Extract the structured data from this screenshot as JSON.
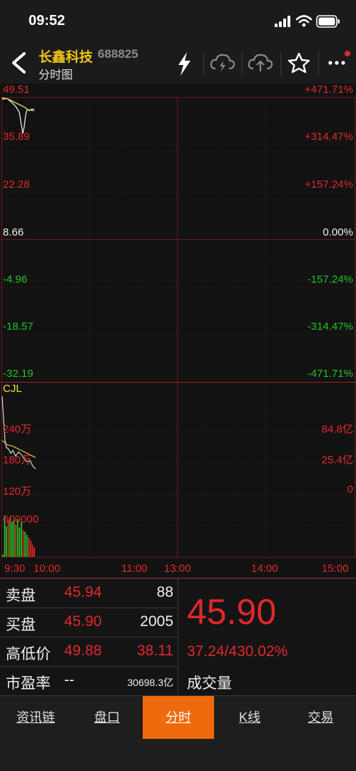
{
  "status_bar": {
    "time": "09:52"
  },
  "header": {
    "stock_name": "长鑫科技",
    "stock_code": "688825",
    "view_title": "分时图",
    "icons": [
      "back-chevron-icon",
      "lightning-icon",
      "cloud-lightning-icon",
      "cloud-upload-icon",
      "star-icon",
      "more-dots-icon"
    ]
  },
  "chart": {
    "price_labels": [
      "49.51",
      "35.89",
      "22.28",
      "8.66",
      "-4.96",
      "-18.57",
      "-32.19"
    ],
    "pct_labels": [
      "+471.71%",
      "+314.47%",
      "+157.24%",
      "0.00%",
      "-157.24%",
      "-314.47%",
      "-471.71%"
    ],
    "volume_title": "CJL",
    "volume_left_labels": [
      "240万",
      "180万",
      "120万",
      "600000"
    ],
    "volume_right_labels": [
      "84.8亿",
      "25.4亿",
      "0"
    ],
    "time_labels": [
      "9:30",
      "10:00",
      "11:00",
      "13:00",
      "14:00",
      "15:00"
    ],
    "colors": {
      "up": "#e0282d",
      "down": "#22c322",
      "grid": "#5a1616",
      "price_line": "#e8e8e8",
      "avg_line": "#e6d84a"
    }
  },
  "quote": {
    "sell_label": "卖盘",
    "sell_price": "45.94",
    "sell_qty": "88",
    "buy_label": "买盘",
    "buy_price": "45.90",
    "buy_qty": "2005",
    "highlow_label": "高低价",
    "high": "49.88",
    "low": "38.11",
    "pe_label": "市盈率",
    "pe_value": "--",
    "market_cap": "30698.3亿",
    "last_price": "45.90",
    "change": "37.24/430.02%",
    "volume_label": "成交量"
  },
  "tabs": [
    {
      "label": "资讯链",
      "active": false
    },
    {
      "label": "盘口",
      "active": false
    },
    {
      "label": "分时",
      "active": true
    },
    {
      "label": "K线",
      "active": false
    },
    {
      "label": "交易",
      "active": false
    }
  ]
}
